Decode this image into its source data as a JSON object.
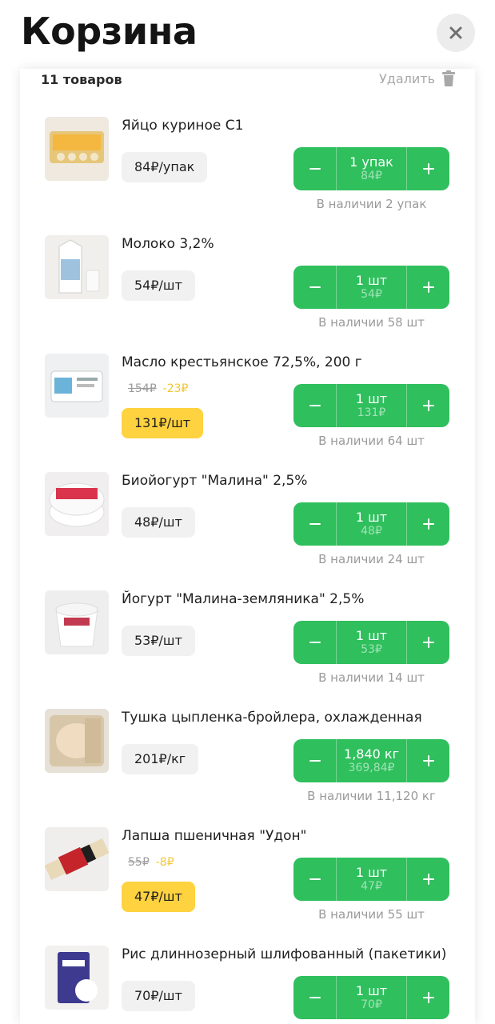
{
  "header": {
    "title": "Корзина"
  },
  "cart": {
    "count_label": "11 товаров",
    "delete_label": "Удалить",
    "items": [
      {
        "name": "Яйцо куриное С1",
        "price": "84₽/упак",
        "old_price": "",
        "discount": "",
        "qty": "1 упак",
        "sum": "84₽",
        "stock": "В наличии 2 упак"
      },
      {
        "name": "Молоко 3,2%",
        "price": "54₽/шт",
        "old_price": "",
        "discount": "",
        "qty": "1 шт",
        "sum": "54₽",
        "stock": "В наличии 58 шт"
      },
      {
        "name": "Масло крестьянское 72,5%, 200 г",
        "price": "131₽/шт",
        "old_price": "154₽",
        "discount": "-23₽",
        "qty": "1 шт",
        "sum": "131₽",
        "stock": "В наличии 64 шт"
      },
      {
        "name": "Биойогурт \"Малина\" 2,5%",
        "price": "48₽/шт",
        "old_price": "",
        "discount": "",
        "qty": "1 шт",
        "sum": "48₽",
        "stock": "В наличии 24 шт"
      },
      {
        "name": "Йогурт \"Малина-земляника\" 2,5%",
        "price": "53₽/шт",
        "old_price": "",
        "discount": "",
        "qty": "1 шт",
        "sum": "53₽",
        "stock": "В наличии 14 шт"
      },
      {
        "name": "Тушка цыпленка-бройлера, охлажденная",
        "price": "201₽/кг",
        "old_price": "",
        "discount": "",
        "qty": "1,840 кг",
        "sum": "369,84₽",
        "stock": "В наличии 11,120 кг"
      },
      {
        "name": "Лапша пшеничная \"Удон\"",
        "price": "47₽/шт",
        "old_price": "55₽",
        "discount": "-8₽",
        "qty": "1 шт",
        "sum": "47₽",
        "stock": "В наличии 55 шт"
      },
      {
        "name": "Рис длиннозерный шлифованный (пакетики)",
        "price": "70₽/шт",
        "old_price": "",
        "discount": "",
        "qty": "1 шт",
        "sum": "70₽",
        "stock": ""
      }
    ]
  },
  "icons": {
    "close": "close-icon",
    "delete": "trash-icon",
    "minus": "minus-icon",
    "plus": "plus-icon"
  },
  "colors": {
    "accent_green": "#2fbf5d",
    "sale_yellow": "#ffd23f",
    "discount_text": "#f2c733"
  }
}
